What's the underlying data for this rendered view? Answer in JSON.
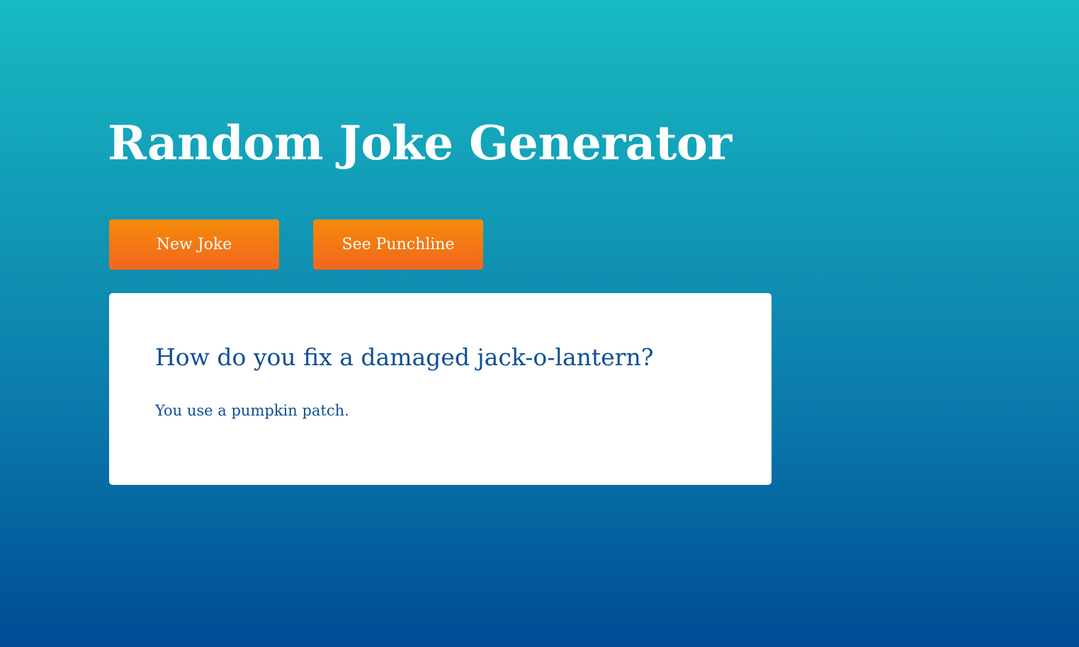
{
  "page": {
    "title": "Random Joke Generator"
  },
  "buttons": {
    "new_joke_label": "New Joke",
    "see_punchline_label": "See Punchline"
  },
  "joke": {
    "setup": "How do you fix a damaged jack-o-lantern?",
    "punchline": "You use a pumpkin patch."
  },
  "colors": {
    "background_top": "#17bbc4",
    "background_bottom": "#004b94",
    "button_top": "#f48b09",
    "button_bottom": "#f2661f",
    "joke_text": "#0e4f93",
    "card": "#ffffff"
  }
}
